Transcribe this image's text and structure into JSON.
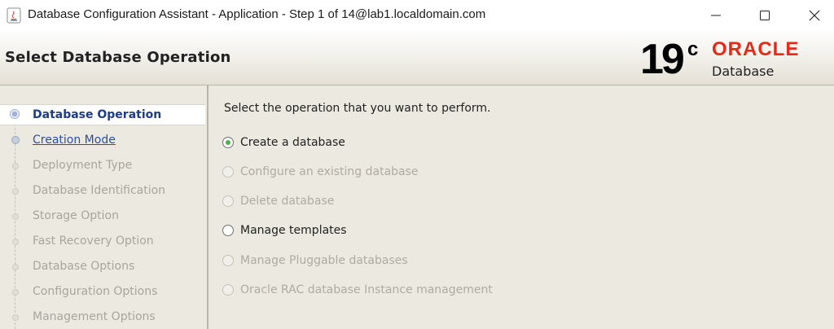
{
  "window": {
    "title": "Database Configuration Assistant - Application - Step 1 of 14@lab1.localdomain.com",
    "app_icon": "java-icon",
    "controls": [
      "minimize-icon",
      "maximize-icon",
      "close-icon"
    ]
  },
  "header": {
    "title": "Select Database Operation",
    "logo_version": "19",
    "logo_suffix": "c",
    "logo_brand": "ORACLE",
    "logo_product": "Database",
    "brand_color": "#e22b1b"
  },
  "nav": {
    "items": [
      {
        "label": "Database Operation",
        "state": "current"
      },
      {
        "label": "Creation Mode",
        "state": "link"
      },
      {
        "label": "Deployment Type",
        "state": "disabled"
      },
      {
        "label": "Database Identification",
        "state": "disabled"
      },
      {
        "label": "Storage Option",
        "state": "disabled"
      },
      {
        "label": "Fast Recovery Option",
        "state": "disabled"
      },
      {
        "label": "Database Options",
        "state": "disabled"
      },
      {
        "label": "Configuration Options",
        "state": "disabled"
      },
      {
        "label": "Management Options",
        "state": "disabled"
      }
    ]
  },
  "main": {
    "prompt": "Select the operation that you want to perform.",
    "options": [
      {
        "label": "Create a database",
        "selected": true,
        "enabled": true
      },
      {
        "label": "Configure an existing database",
        "selected": false,
        "enabled": false
      },
      {
        "label": "Delete database",
        "selected": false,
        "enabled": false
      },
      {
        "label": "Manage templates",
        "selected": false,
        "enabled": true
      },
      {
        "label": "Manage Pluggable databases",
        "selected": false,
        "enabled": false
      },
      {
        "label": "Oracle RAC database Instance management",
        "selected": false,
        "enabled": false
      }
    ]
  }
}
